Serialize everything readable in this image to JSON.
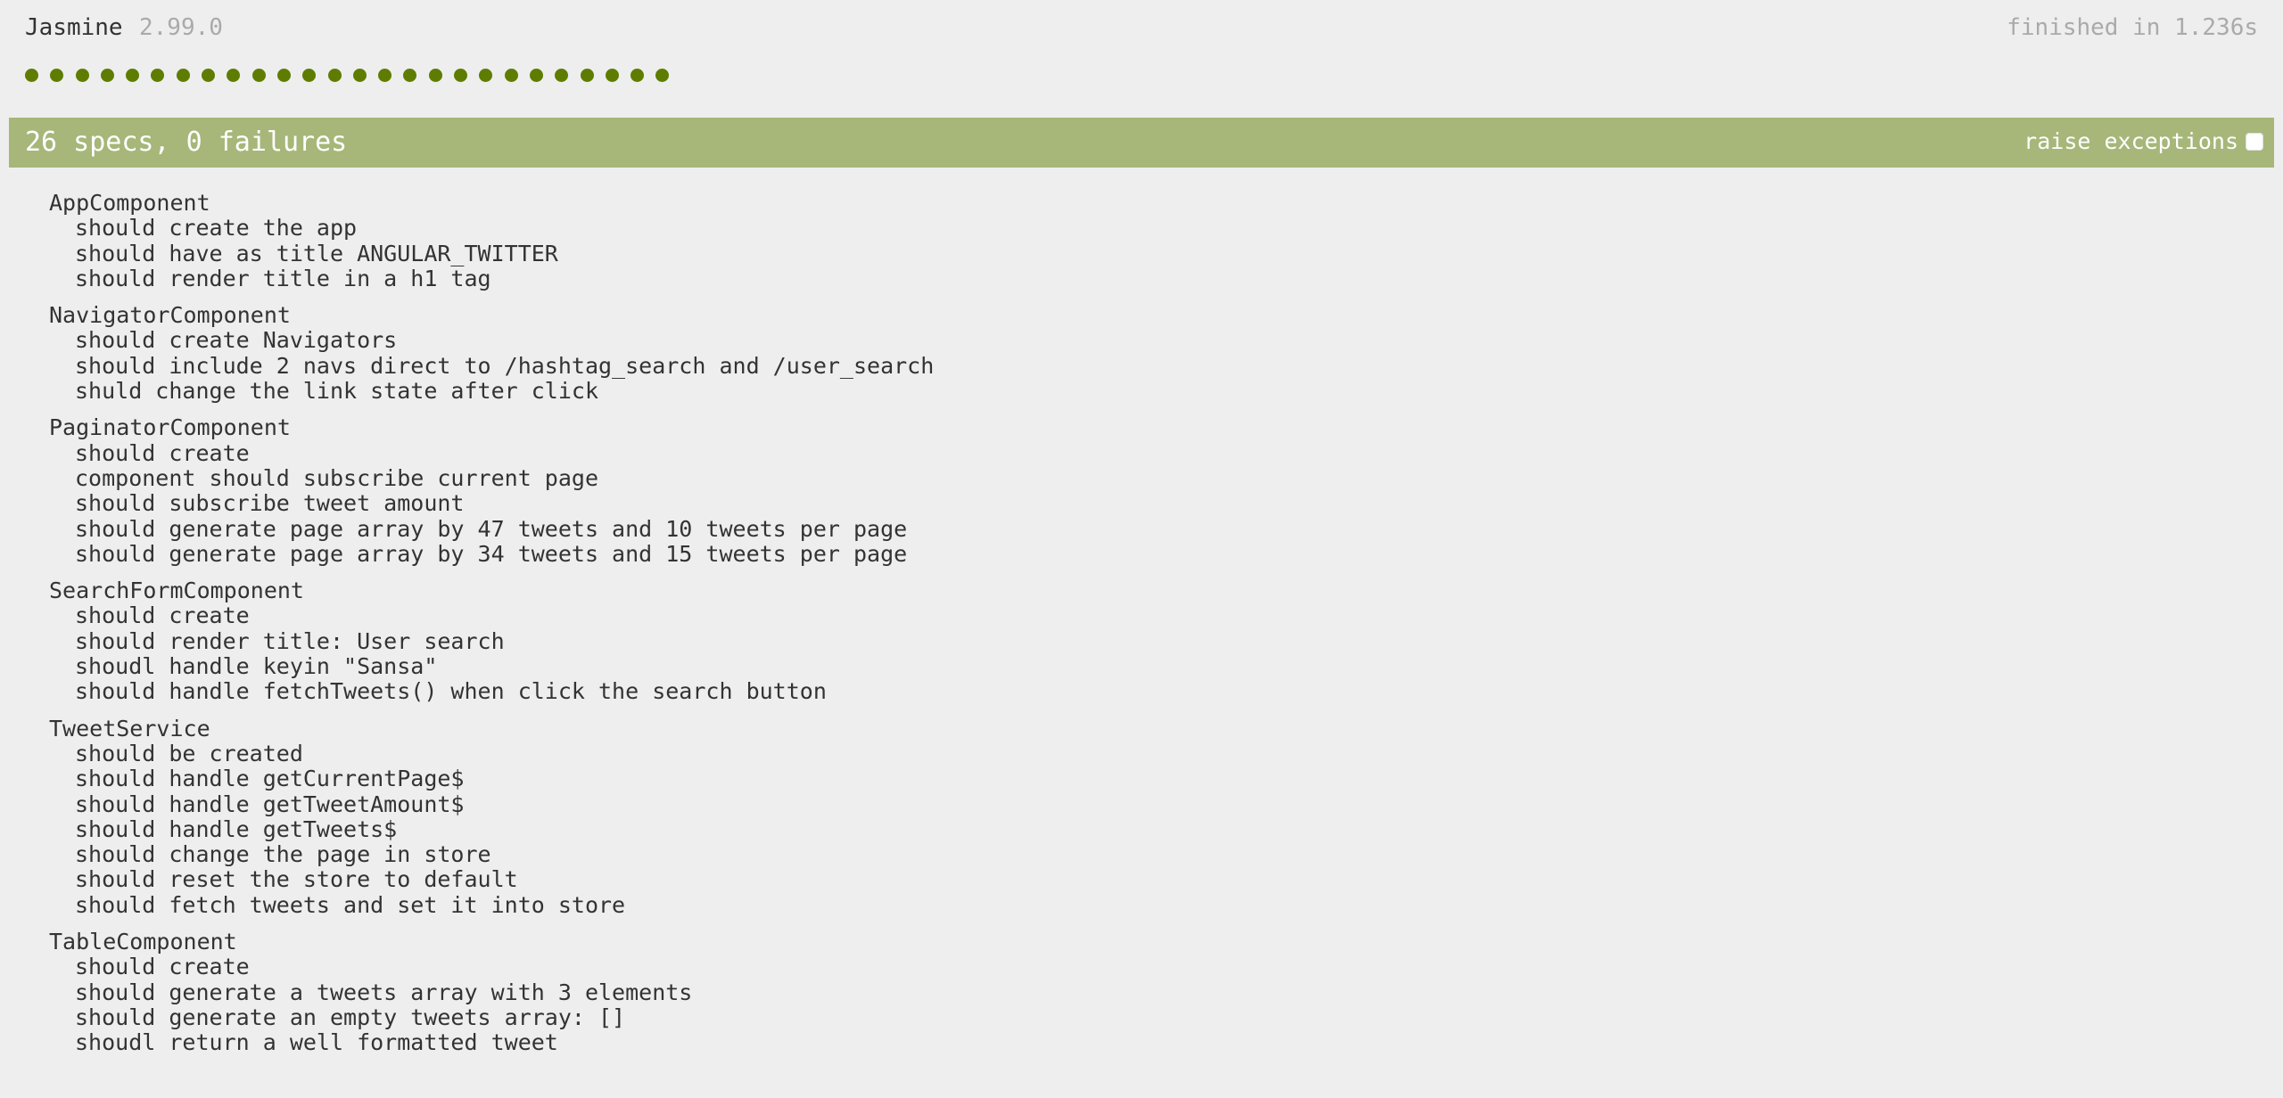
{
  "header": {
    "title": "Jasmine",
    "version": "2.99.0",
    "duration": "finished in 1.236s"
  },
  "dots": {
    "count": 26,
    "color": "#5e7d00",
    "status": "passed"
  },
  "bar": {
    "label": "26 specs, 0 failures",
    "raise_exceptions_label": "raise exceptions",
    "raise_exceptions_checked": false,
    "color": "#a6b779"
  },
  "suites": [
    {
      "name": "AppComponent",
      "specs": [
        "should create the app",
        "should have as title ANGULAR_TWITTER",
        "should render title in a h1 tag"
      ]
    },
    {
      "name": "NavigatorComponent",
      "specs": [
        "should create Navigators",
        "should include 2 navs direct to /hashtag_search and /user_search",
        "shuld change the link state after click"
      ]
    },
    {
      "name": "PaginatorComponent",
      "specs": [
        "should create",
        "component should subscribe current page",
        "should subscribe tweet amount",
        "should generate page array by 47 tweets and 10 tweets per page",
        "should generate page array by 34 tweets and 15 tweets per page"
      ]
    },
    {
      "name": "SearchFormComponent",
      "specs": [
        "should create",
        "should render title: User search",
        "shoudl handle keyin \"Sansa\"",
        "should handle fetchTweets() when click the search button"
      ]
    },
    {
      "name": "TweetService",
      "specs": [
        "should be created",
        "should handle getCurrentPage$",
        "should handle getTweetAmount$",
        "should handle getTweets$",
        "should change the page in store",
        "should reset the store to default",
        "should fetch tweets and set it into store"
      ]
    },
    {
      "name": "TableComponent",
      "specs": [
        "should create",
        "should generate a tweets array with 3 elements",
        "should generate an empty tweets array: []",
        "shoudl return a well formatted tweet"
      ]
    }
  ]
}
